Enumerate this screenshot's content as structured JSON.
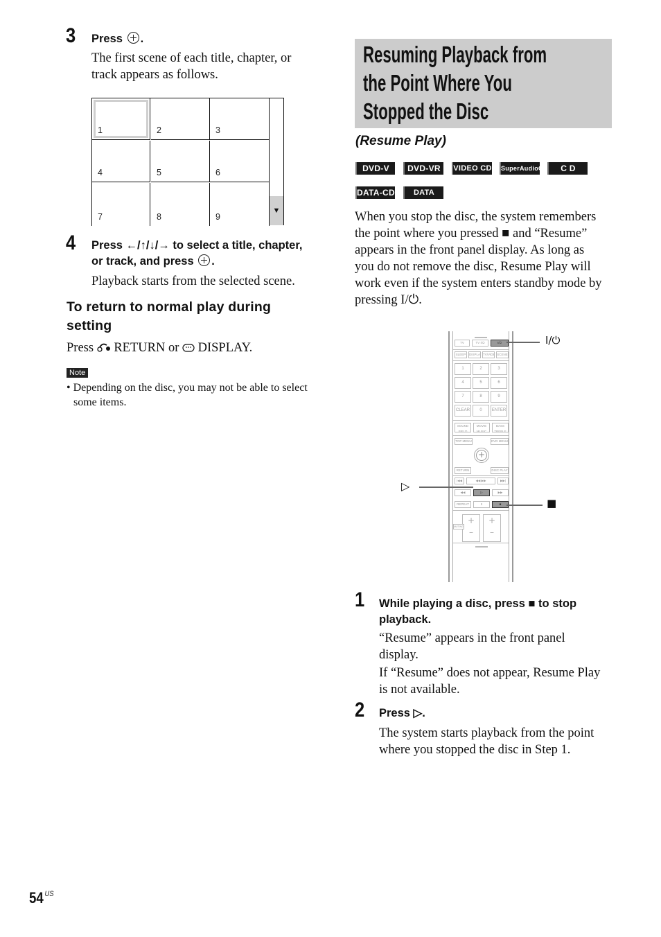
{
  "left_column": {
    "step3": {
      "number": "3",
      "heading_prefix": "Press",
      "heading_icon": "enter-button-icon",
      "heading_suffix": ".",
      "body": [
        "The first scene of each title, chapter, or",
        "track appears as follows."
      ]
    },
    "scene_grid": {
      "cells": [
        "1",
        "2",
        "3",
        "4",
        "5",
        "6",
        "7",
        "8",
        "9"
      ],
      "selected_cell": "1",
      "scroll_arrow": "▼"
    },
    "step4": {
      "number": "4",
      "heading_line1": "Press ←/↑/↓/→ to select a title, chapter,",
      "heading_line2_prefix": "or track, and press",
      "heading_line2_suffix": ".",
      "body": "Playback starts from the selected scene."
    },
    "subsection": {
      "heading_line1": "To return to normal play during",
      "heading_line2": "setting",
      "body_prefix": "Press",
      "return_label": "RETURN or",
      "display_label": "DISPLAY."
    },
    "note": {
      "badge": "Note",
      "line1": "• Depending on the disc, you may not be able to select",
      "line2": "some items."
    }
  },
  "right_column": {
    "title_lines": [
      "Resuming Playback from",
      "the Point Where You",
      "Stopped the Disc"
    ],
    "subtitle": "(Resume Play)",
    "disc_badges": [
      "DVD-V",
      "DVD-VR",
      "VIDEO CD",
      "SuperAudioCD",
      "C D",
      "DATA-CD",
      "DATA DVD"
    ],
    "intro": [
      "When you stop the disc, the system remembers",
      "the point where you pressed ■ and “Resume”",
      "appears in the front panel display. As long as",
      "you do not remove the disc, Resume Play will",
      "work even if the system enters standby mode by",
      "pressing I/⏻."
    ],
    "remote": {
      "callouts": {
        "power": "I/⏻",
        "play": "▷",
        "stop": "■"
      },
      "rows": [
        [
          "TV",
          "TV I/⏻",
          "I/⏻"
        ],
        [
          "SLEEP",
          "DISPLAY",
          "TV/VIDEO",
          "SCENE SYNC"
        ],
        [
          "1",
          "2",
          "3"
        ],
        [
          "4",
          "5",
          "6"
        ],
        [
          "7",
          "8",
          "9"
        ],
        [
          "CLEAR",
          "0",
          "ENTER"
        ],
        [
          "SOUND FIELD",
          "MOVIE MUSIC",
          "BASS TREBLE"
        ],
        [
          "TOP MENU",
          "DVD MENU"
        ],
        [
          "RETURN",
          "DISC PLAY"
        ],
        [
          "|◀◀",
          "◀◀ ▶▶",
          "▶▶|"
        ],
        [
          "◀◀",
          "▷",
          "▶▶"
        ],
        [
          "REPEAT",
          "II",
          "■"
        ],
        [
          "MUTING"
        ]
      ]
    },
    "step1": {
      "number": "1",
      "heading_line1": "While playing a disc, press ■ to stop",
      "heading_line2": "playback.",
      "body": [
        "“Resume” appears in the front panel",
        "display.",
        "If “Resume” does not appear, Resume Play",
        "is not available."
      ]
    },
    "step2": {
      "number": "2",
      "heading": "Press ▷.",
      "body": [
        "The system starts playback from the point",
        "where you stopped the disc in Step 1."
      ]
    }
  },
  "footer": {
    "page_number": "54",
    "region": "US"
  }
}
